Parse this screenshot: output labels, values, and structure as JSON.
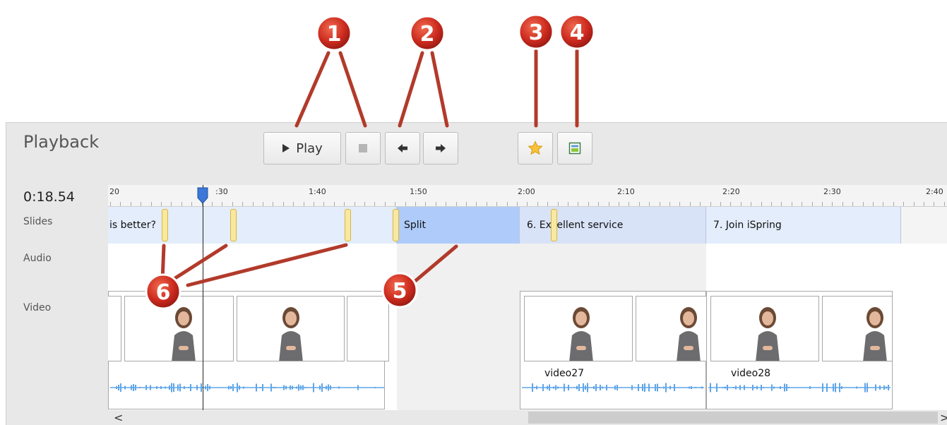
{
  "panel": {
    "title": "Playback"
  },
  "toolbar": {
    "play_label": "Play",
    "stop_icon": "stop-icon",
    "prev_icon": "arrow-left-icon",
    "next_icon": "arrow-right-icon",
    "marker_icon": "star-icon",
    "split_icon": "slide-icon"
  },
  "timeline": {
    "current_time": "0:18.54",
    "tracks": [
      "Slides",
      "Audio",
      "Video"
    ],
    "ruler_labels": [
      "20",
      ":30",
      "1:40",
      "1:50",
      "2:00",
      "2:10",
      "2:20",
      "2:30",
      "2:40"
    ],
    "slides": [
      {
        "label": "is better?"
      },
      {
        "label": "Split"
      },
      {
        "label": "6. Excellent service"
      },
      {
        "label": "7. Join iSpring"
      }
    ],
    "video_clips": [
      {
        "label": ""
      },
      {
        "label": "video27"
      },
      {
        "label": "video28"
      }
    ]
  },
  "scrollbar": {
    "left_arrow": "<",
    "right_arrow": ">"
  },
  "callouts": [
    "1",
    "2",
    "3",
    "4",
    "5",
    "6"
  ],
  "colors": {
    "callout_red": "#cc2a1e",
    "callout_line": "#b23a2b",
    "split_slide": "#aecbfa",
    "slide_light": "#e3edfb",
    "slide_mid": "#d8e3f8",
    "waveform": "#5fa5e8",
    "playhead": "#3c78d8"
  }
}
